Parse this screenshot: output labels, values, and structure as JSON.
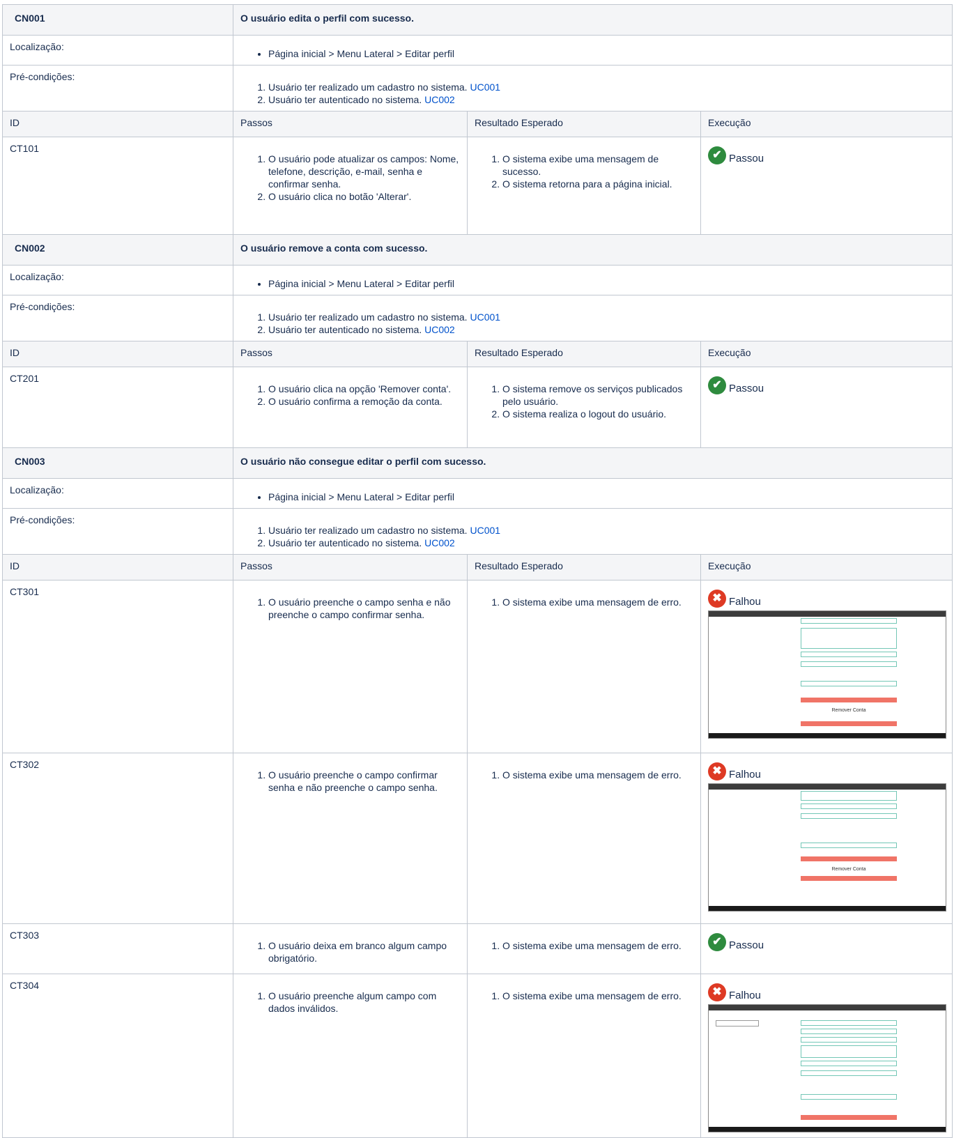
{
  "links": {
    "uc001": "UC001",
    "uc002": "UC002"
  },
  "colors": {
    "pass": "#2e8b3e",
    "fail": "#de3a24",
    "link": "#0052cc",
    "header_bg": "#f4f5f7"
  },
  "column_headers": {
    "id": "ID",
    "steps": "Passos",
    "expected": "Resultado Esperado",
    "execution": "Execução"
  },
  "labels": {
    "location": "Localização:",
    "preconditions": "Pré-condições:"
  },
  "scenarios": [
    {
      "id": "CN001",
      "title": "O usuário edita o perfil com sucesso.",
      "location": "Página inicial > Menu Lateral > Editar perfil",
      "preconditions": [
        "Usuário ter realizado um cadastro no sistema.",
        "Usuário ter autenticado no sistema."
      ],
      "cases": [
        {
          "id": "CT101",
          "steps": [
            "O usuário pode atualizar os campos: Nome, telefone, descrição, e-mail, senha e confirmar senha.",
            "O usuário clica no botão 'Alterar'."
          ],
          "expected": [
            "O sistema exibe uma mensagem de sucesso.",
            "O sistema retorna para a página inicial."
          ],
          "execution": {
            "status": "Passou",
            "icon": "check-circle-icon"
          }
        }
      ]
    },
    {
      "id": "CN002",
      "title": "O usuário remove a conta com sucesso.",
      "location": "Página inicial > Menu Lateral > Editar perfil",
      "preconditions": [
        "Usuário ter realizado um cadastro no sistema.",
        "Usuário ter autenticado no sistema."
      ],
      "cases": [
        {
          "id": "CT201",
          "steps": [
            "O usuário clica na opção 'Remover conta'.",
            "O usuário confirma a remoção da conta."
          ],
          "expected": [
            "O sistema remove os serviços publicados pelo usuário.",
            "O sistema realiza o logout do usuário."
          ],
          "execution": {
            "status": "Passou",
            "icon": "check-circle-icon"
          }
        }
      ]
    },
    {
      "id": "CN003",
      "title": "O usuário não consegue editar o perfil com sucesso.",
      "location": "Página inicial > Menu Lateral > Editar perfil",
      "preconditions": [
        "Usuário ter realizado um cadastro no sistema.",
        "Usuário ter autenticado no sistema."
      ],
      "cases": [
        {
          "id": "CT301",
          "steps": [
            "O usuário preenche o campo senha e não preenche o campo confirmar senha."
          ],
          "expected": [
            "O sistema exibe uma mensagem de erro."
          ],
          "execution": {
            "status": "Falhou",
            "icon": "x-circle-icon"
          },
          "screenshot": {
            "title": "Remover Conta"
          }
        },
        {
          "id": "CT302",
          "steps": [
            "O usuário preenche o campo confirmar senha e não preenche o campo senha."
          ],
          "expected": [
            "O sistema exibe uma mensagem de erro."
          ],
          "execution": {
            "status": "Falhou",
            "icon": "x-circle-icon"
          },
          "screenshot": {
            "title": "Remover Conta"
          }
        },
        {
          "id": "CT303",
          "steps": [
            "O usuário deixa em branco algum campo obrigatório."
          ],
          "expected": [
            "O sistema exibe uma mensagem de erro."
          ],
          "execution": {
            "status": "Passou",
            "icon": "check-circle-icon"
          }
        },
        {
          "id": "CT304",
          "steps": [
            "O usuário preenche algum campo com dados inválidos."
          ],
          "expected": [
            "O sistema exibe uma mensagem de erro."
          ],
          "execution": {
            "status": "Falhou",
            "icon": "x-circle-icon"
          },
          "screenshot": {
            "title": ""
          }
        }
      ]
    }
  ]
}
